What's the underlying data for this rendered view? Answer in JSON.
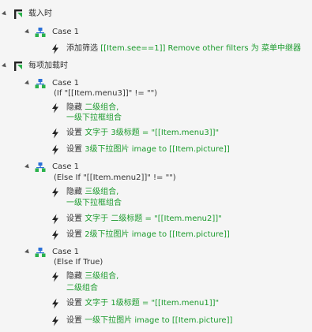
{
  "colors": {
    "green": "#1a9a2c",
    "text": "#333333",
    "icon_dark": "#222222",
    "icon_green": "#2bb24c",
    "icon_blue": "#2a6fd6",
    "background": "#f5f5f5"
  },
  "tree": [
    {
      "kind": "event",
      "label": "载入时",
      "expanded": true
    },
    {
      "kind": "case",
      "label": "Case 1",
      "expanded": true
    },
    {
      "kind": "action",
      "parts": [
        {
          "text": "添加筛选 ",
          "color": "text"
        },
        {
          "text": "[[Item.see==1]] Remove other filters 为 菜单中继器",
          "color": "green"
        }
      ]
    },
    {
      "kind": "event",
      "label": "每项加载时",
      "expanded": true
    },
    {
      "kind": "case",
      "label": "Case 1",
      "expanded": true
    },
    {
      "kind": "condition",
      "label": "(If \"[[Item.menu3]]\" != \"\")"
    },
    {
      "kind": "action",
      "parts": [
        {
          "text": "隐藏 ",
          "color": "text"
        },
        {
          "text": "二级组合,",
          "color": "green"
        }
      ]
    },
    {
      "kind": "continuation",
      "parts": [
        {
          "text": "一级下拉框组合",
          "color": "green"
        }
      ]
    },
    {
      "kind": "action",
      "parts": [
        {
          "text": "设置 ",
          "color": "text"
        },
        {
          "text": "文字于 3级标题 = \"[[Item.menu3]]\"",
          "color": "green"
        }
      ]
    },
    {
      "kind": "action",
      "parts": [
        {
          "text": "设置 ",
          "color": "text"
        },
        {
          "text": "3级下拉图片 image to [[Item.picture]]",
          "color": "green"
        }
      ]
    },
    {
      "kind": "case",
      "label": "Case 1",
      "expanded": true
    },
    {
      "kind": "condition",
      "label": "(Else If \"[[Item.menu2]]\" != \"\")"
    },
    {
      "kind": "action",
      "parts": [
        {
          "text": "隐藏 ",
          "color": "text"
        },
        {
          "text": "三级组合,",
          "color": "green"
        }
      ]
    },
    {
      "kind": "continuation",
      "parts": [
        {
          "text": "一级下拉框组合",
          "color": "green"
        }
      ]
    },
    {
      "kind": "action",
      "parts": [
        {
          "text": "设置 ",
          "color": "text"
        },
        {
          "text": "文字于 二级标题 = \"[[Item.menu2]]\"",
          "color": "green"
        }
      ]
    },
    {
      "kind": "action",
      "parts": [
        {
          "text": "设置 ",
          "color": "text"
        },
        {
          "text": "2级下拉图片 image to [[Item.picture]]",
          "color": "green"
        }
      ]
    },
    {
      "kind": "case",
      "label": "Case 1",
      "expanded": true
    },
    {
      "kind": "condition",
      "label": "(Else If True)"
    },
    {
      "kind": "action",
      "parts": [
        {
          "text": "隐藏 ",
          "color": "text"
        },
        {
          "text": "三级组合,",
          "color": "green"
        }
      ]
    },
    {
      "kind": "continuation",
      "parts": [
        {
          "text": "二级组合",
          "color": "green"
        }
      ]
    },
    {
      "kind": "action",
      "parts": [
        {
          "text": "设置 ",
          "color": "text"
        },
        {
          "text": "文字于 1级标题 = \"[[Item.menu1]]\"",
          "color": "green"
        }
      ]
    },
    {
      "kind": "action",
      "parts": [
        {
          "text": "设置 ",
          "color": "text"
        },
        {
          "text": "一级下拉图片 image to [[Item.picture]]",
          "color": "green"
        }
      ]
    }
  ]
}
